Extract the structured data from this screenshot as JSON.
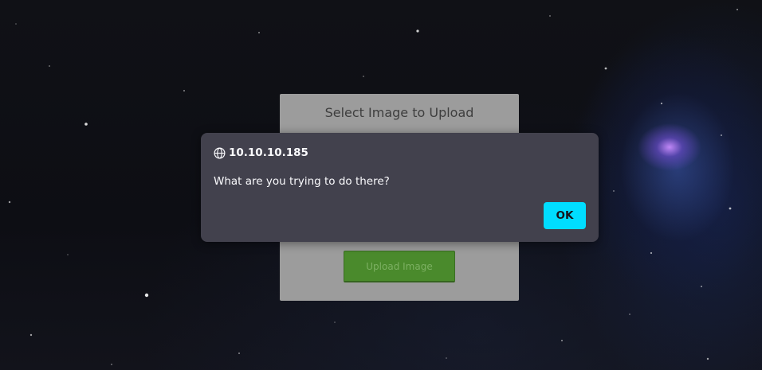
{
  "background": {
    "description_icon": "starfield-galaxy-icon"
  },
  "upload_panel": {
    "title": "Select Image to Upload",
    "button_label": "Upload Image"
  },
  "alert": {
    "origin": "10.10.10.185",
    "message": "What are you trying to do there?",
    "ok_label": "OK",
    "origin_icon": "globe-icon",
    "accent_color": "#00ddff"
  }
}
